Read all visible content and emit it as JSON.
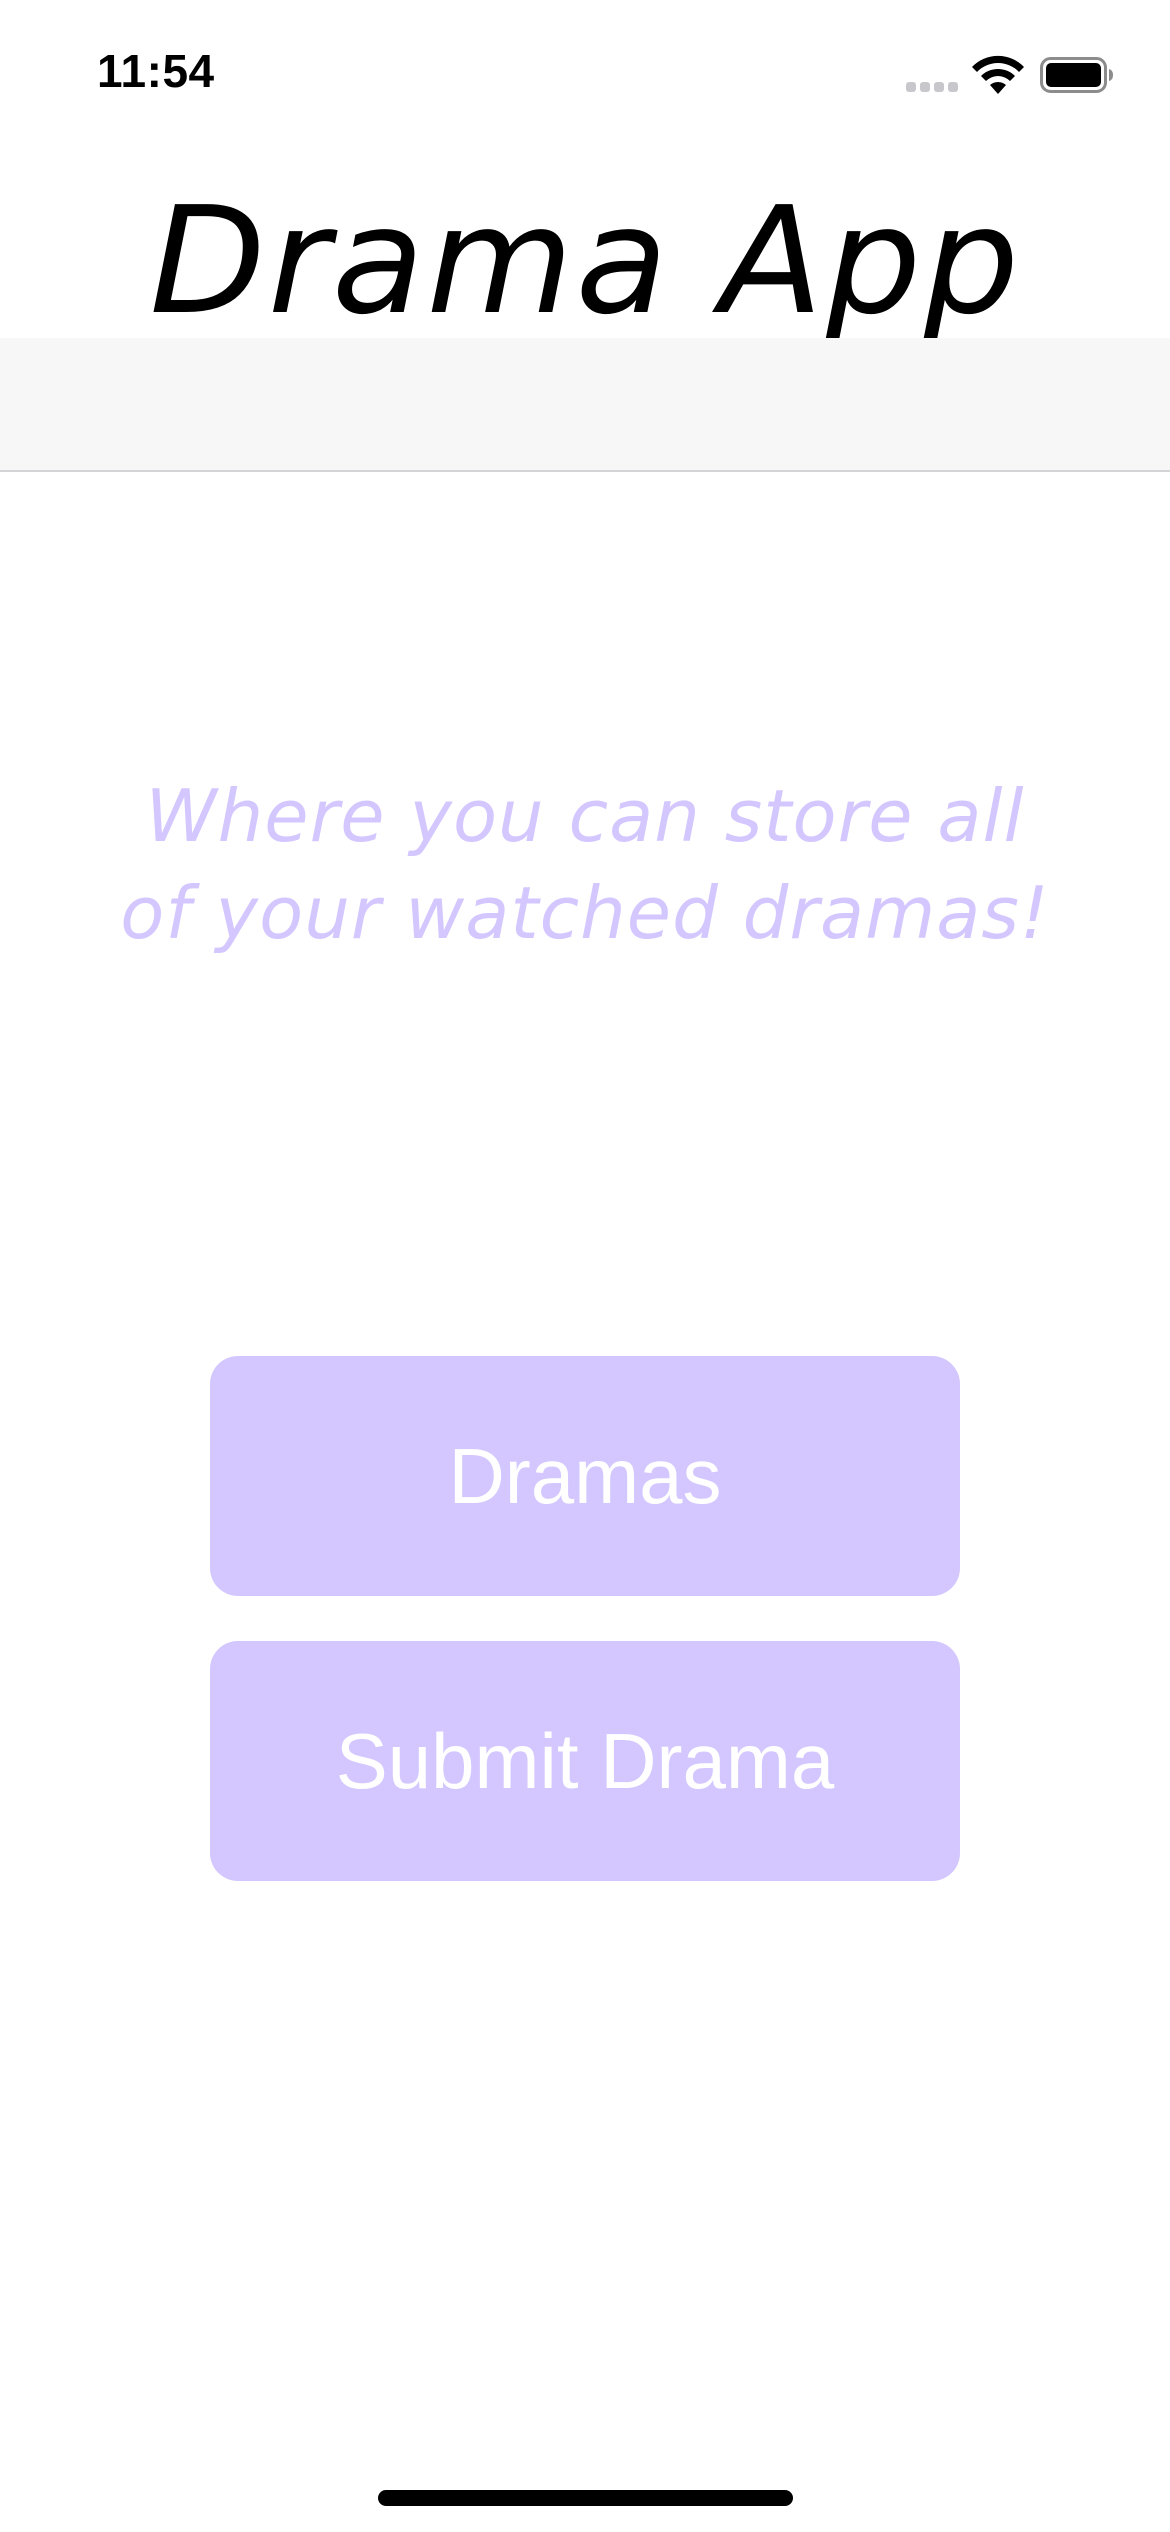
{
  "status_bar": {
    "time": "11:54",
    "signal_icon": "cellular-signal-icon",
    "wifi_icon": "wifi-icon",
    "battery_icon": "battery-icon"
  },
  "header": {
    "title": "Drama App"
  },
  "main": {
    "tagline": "Where you can store all of your watched dramas!",
    "buttons": {
      "dramas": "Dramas",
      "submit": "Submit Drama"
    }
  },
  "colors": {
    "accent": "#d4c7ff",
    "button_text": "#ffffff",
    "nav_bar_background": "#f7f7f7"
  }
}
